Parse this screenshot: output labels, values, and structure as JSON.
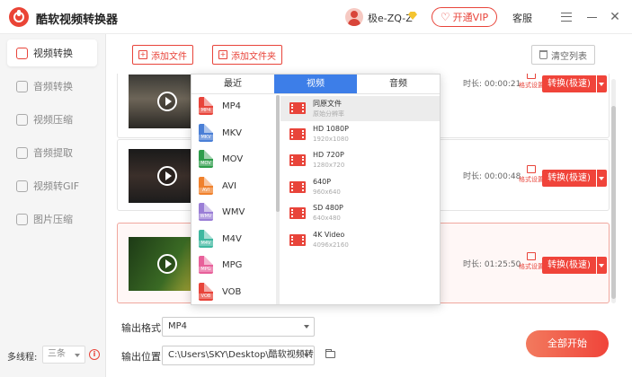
{
  "app": {
    "title": "酷软视频转换器"
  },
  "header": {
    "username": "极e-ZQ-Z",
    "vip_label": "开通VIP",
    "service_label": "客服"
  },
  "sidebar": {
    "items": [
      {
        "label": "视频转换",
        "active": true
      },
      {
        "label": "音频转换",
        "active": false
      },
      {
        "label": "视频压缩",
        "active": false
      },
      {
        "label": "音频提取",
        "active": false
      },
      {
        "label": "视频转GIF",
        "active": false
      },
      {
        "label": "图片压缩",
        "active": false
      }
    ],
    "threads_label": "多线程:",
    "threads_value": "三条"
  },
  "toolbar": {
    "add_file": "添加文件",
    "add_folder": "添加文件夹",
    "clear_list": "清空列表"
  },
  "files": [
    {
      "duration": "时长: 00:00:21",
      "format_setting": "格式设置",
      "convert_label": "转换(极速)"
    },
    {
      "duration": "时长: 00:00:48",
      "format_setting": "格式设置",
      "convert_label": "转换(极速)"
    },
    {
      "duration": "时长: 01:25:50",
      "format_setting": "格式设置",
      "convert_label": "转换(极速)"
    }
  ],
  "format_dropdown": {
    "tabs": [
      "最近",
      "视频",
      "音频"
    ],
    "active_tab": "视频",
    "formats": [
      {
        "label": "MP4",
        "color": "#e8443a"
      },
      {
        "label": "MKV",
        "color": "#4a7fd6"
      },
      {
        "label": "MOV",
        "color": "#2e9d4b"
      },
      {
        "label": "AVI",
        "color": "#f0812c"
      },
      {
        "label": "WMV",
        "color": "#9a7ed6"
      },
      {
        "label": "M4V",
        "color": "#3fb8a0"
      },
      {
        "label": "MPG",
        "color": "#e8609a"
      },
      {
        "label": "VOB",
        "color": "#e8443a"
      }
    ],
    "resolutions": [
      {
        "name": "同原文件",
        "size": "原始分辨率"
      },
      {
        "name": "HD 1080P",
        "size": "1920x1080"
      },
      {
        "name": "HD 720P",
        "size": "1280x720"
      },
      {
        "name": "640P",
        "size": "960x640"
      },
      {
        "name": "SD 480P",
        "size": "640x480"
      },
      {
        "name": "4K Video",
        "size": "4096x2160"
      }
    ]
  },
  "output": {
    "format_label": "输出格式",
    "format_value": "MP4",
    "location_label": "输出位置",
    "location_value": "C:\\Users\\SKY\\Desktop\\酷软视频转换器"
  },
  "start_all": "全部开始"
}
